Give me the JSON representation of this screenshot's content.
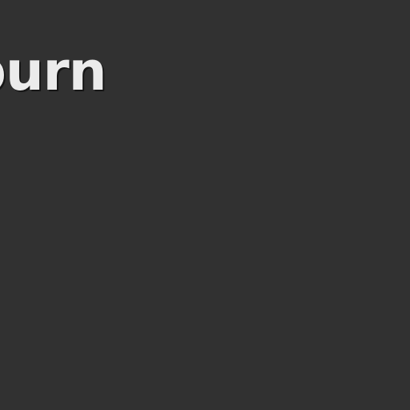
{
  "page": {
    "title_text": "burn",
    "background_color": "#313131",
    "title_color": "#ebebeb"
  }
}
